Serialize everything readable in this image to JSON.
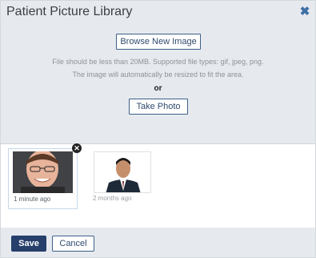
{
  "dialog": {
    "title": "Patient Picture Library",
    "close_icon": "close-icon"
  },
  "upload": {
    "browse_label": "Browse New Image",
    "hint_line1": "File should be less than 20MB. Supported file types: gif, jpeg, png.",
    "hint_line2": "The image will automatically be resized to fit the area.",
    "or_label": "or",
    "take_photo_label": "Take Photo"
  },
  "gallery": {
    "items": [
      {
        "time": "1 minute ago",
        "selected": true
      },
      {
        "time": "2 months ago",
        "selected": false
      }
    ],
    "remove_icon": "close-circle-icon"
  },
  "footer": {
    "save_label": "Save",
    "cancel_label": "Cancel"
  },
  "colors": {
    "accent": "#263f6b",
    "panel_bg": "#e6eaee",
    "selected_border": "#c6d8ea"
  }
}
